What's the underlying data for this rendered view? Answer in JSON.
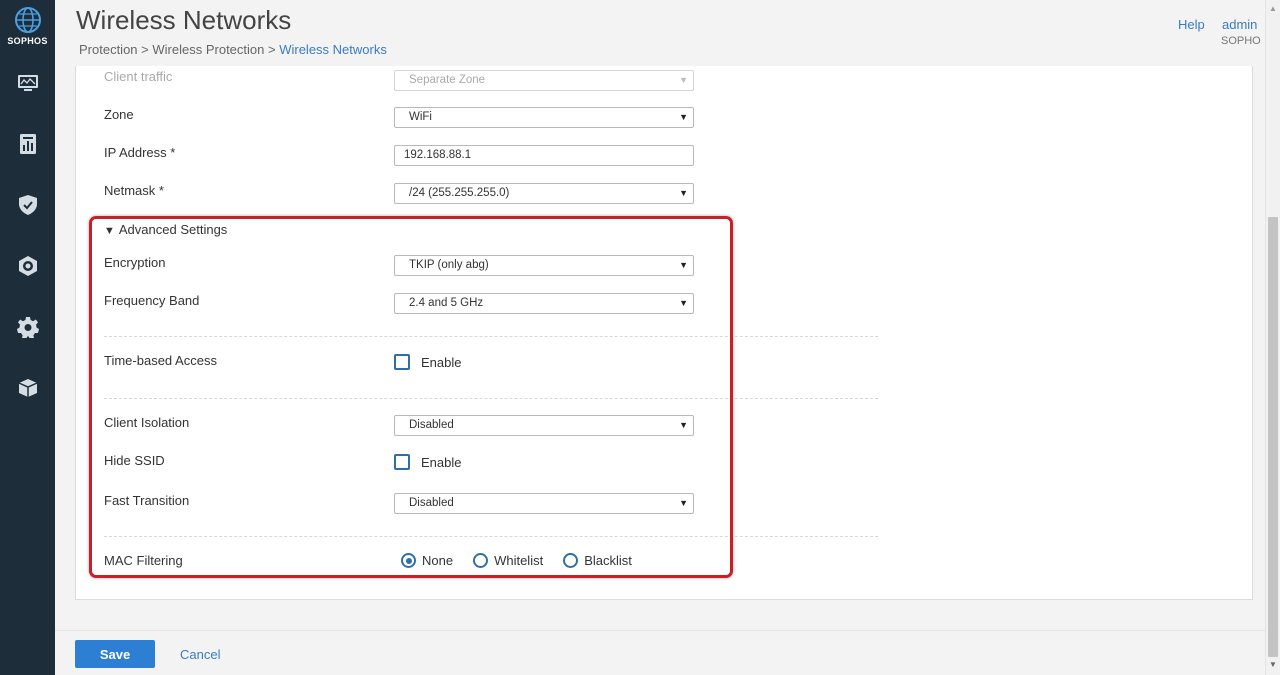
{
  "sidebar": {
    "brand": "SOPHOS",
    "items": [
      {
        "icon": "monitor-icon"
      },
      {
        "icon": "reports-icon"
      },
      {
        "icon": "shield-icon"
      },
      {
        "icon": "protection-icon"
      },
      {
        "icon": "gear-icon"
      },
      {
        "icon": "box-icon"
      }
    ]
  },
  "header": {
    "title": "Wireless Networks",
    "breadcrumb": {
      "part1": "Protection",
      "sep": ">",
      "part2": "Wireless Protection",
      "current": "Wireless Networks"
    },
    "help": "Help",
    "user": "admin",
    "org": "SOPHOS"
  },
  "form": {
    "client_traffic": {
      "label": "Client traffic",
      "value": "Separate Zone"
    },
    "zone": {
      "label": "Zone",
      "value": "WiFi"
    },
    "ip_address": {
      "label": "IP Address *",
      "value": "192.168.88.1"
    },
    "netmask": {
      "label": "Netmask *",
      "value": "/24 (255.255.255.0)"
    },
    "advanced": {
      "toggle_icon": "▼",
      "label": "Advanced Settings",
      "encryption": {
        "label": "Encryption",
        "value": "TKIP (only abg)"
      },
      "frequency_band": {
        "label": "Frequency Band",
        "value": "2.4 and 5 GHz"
      },
      "time_based_access": {
        "label": "Time-based Access",
        "checkbox_label": "Enable",
        "checked": false
      },
      "client_isolation": {
        "label": "Client Isolation",
        "value": "Disabled"
      },
      "hide_ssid": {
        "label": "Hide SSID",
        "checkbox_label": "Enable",
        "checked": false
      },
      "fast_transition": {
        "label": "Fast Transition",
        "value": "Disabled"
      },
      "mac_filtering": {
        "label": "MAC Filtering",
        "options": [
          "None",
          "Whitelist",
          "Blacklist"
        ],
        "selected": "None"
      }
    }
  },
  "footer": {
    "save": "Save",
    "cancel": "Cancel"
  },
  "colors": {
    "sidebar": "#1d2d3a",
    "accent": "#2d7fd3",
    "link": "#3a7cc0",
    "highlight": "#c8202b"
  }
}
